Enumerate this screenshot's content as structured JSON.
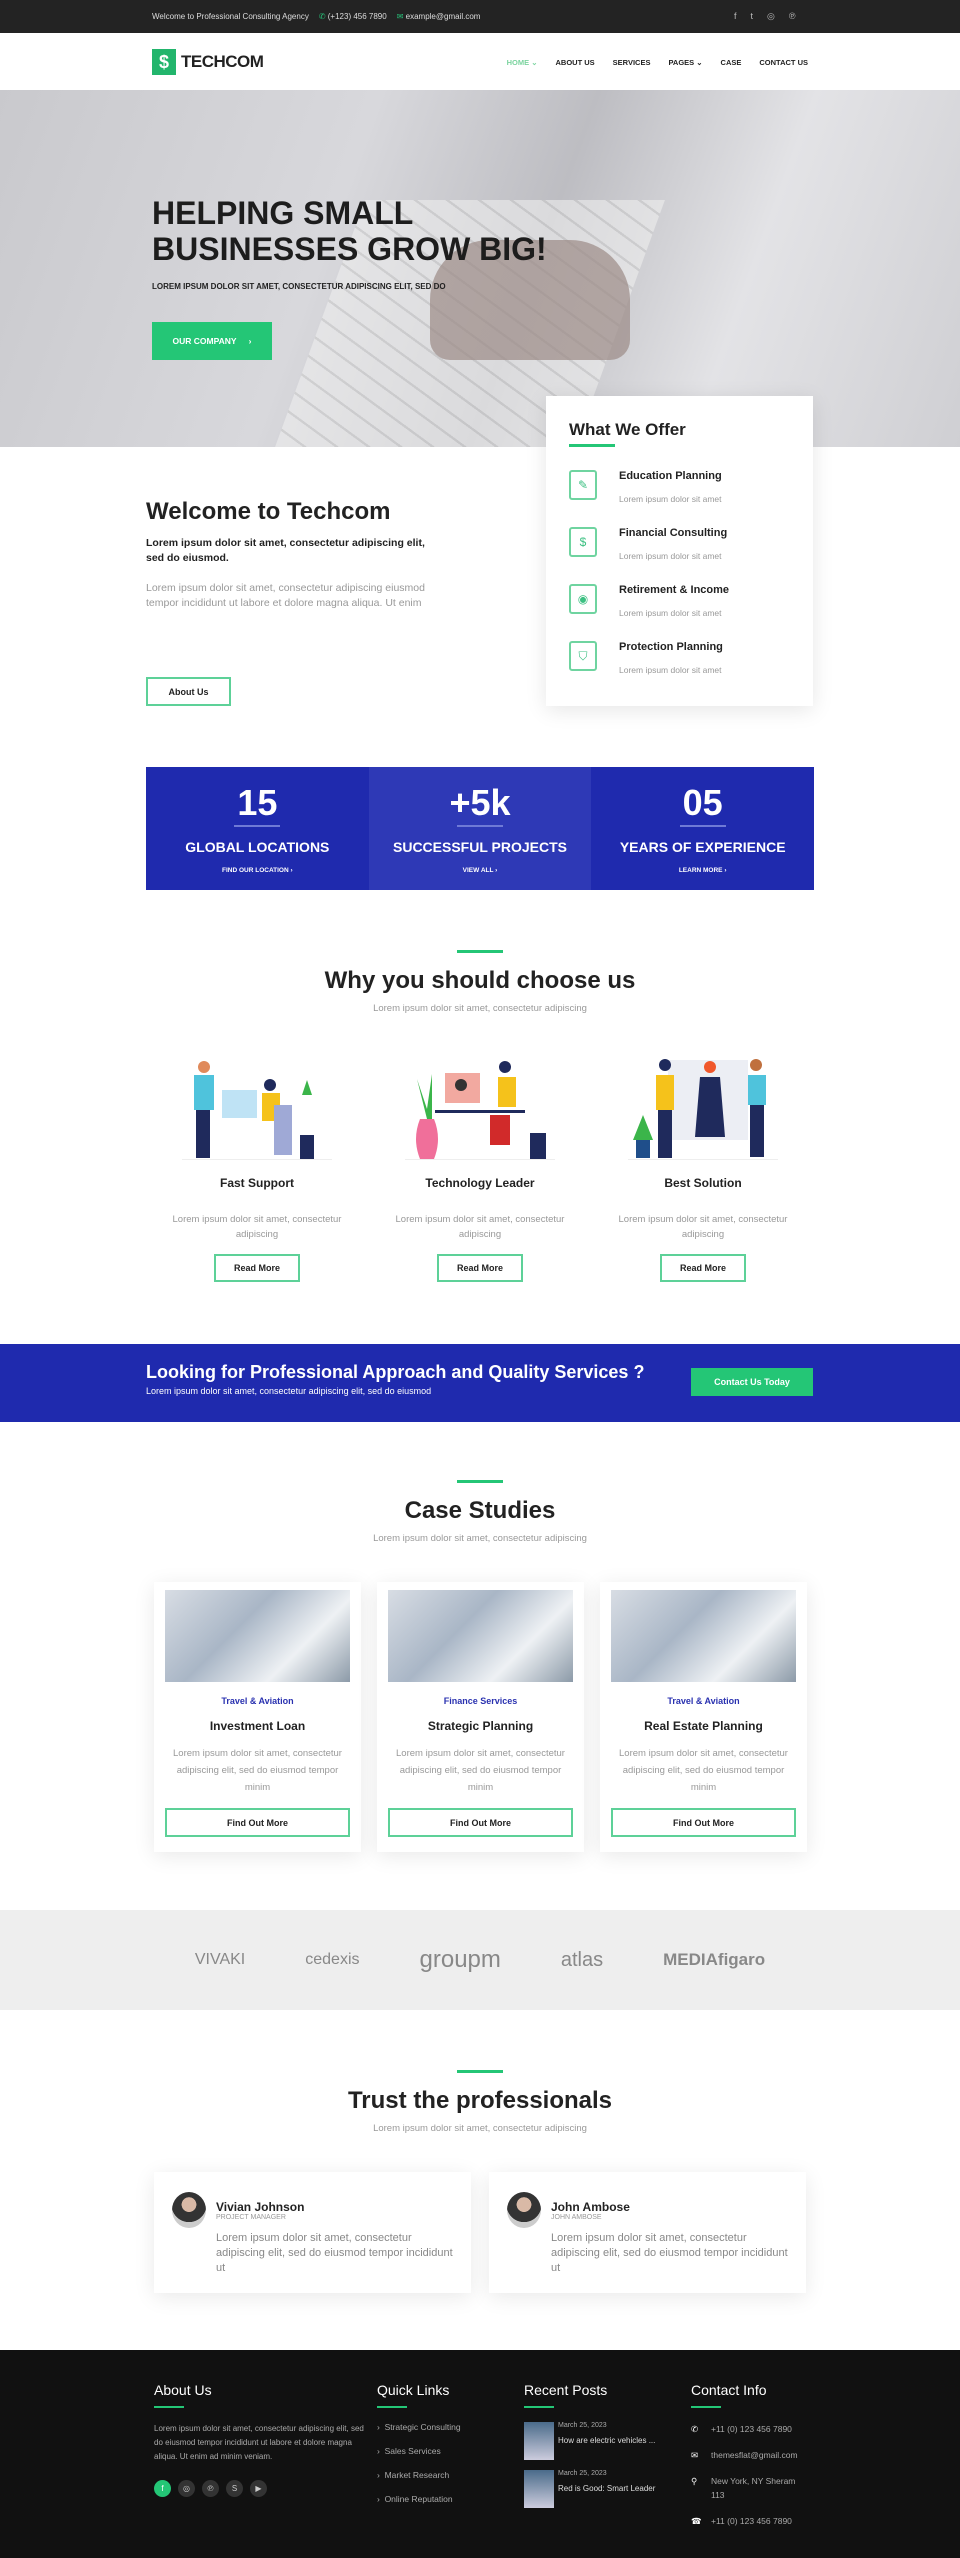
{
  "colors": {
    "accent": "#24c676",
    "brand_blue": "#1f2aae",
    "footer": "#111111"
  },
  "topbar": {
    "welcome": "Welcome to Professional Consulting Agency",
    "phone": "(+123) 456 7890",
    "email": "example@gmail.com",
    "social_icons": [
      "facebook-icon",
      "twitter-icon",
      "instagram-icon",
      "pinterest-icon"
    ]
  },
  "header": {
    "logo_text": "TECHCOM",
    "nav": [
      {
        "label": "HOME",
        "active": true
      },
      {
        "label": "ABOUT US"
      },
      {
        "label": "SERVICES"
      },
      {
        "label": "PAGES"
      },
      {
        "label": "CASE"
      },
      {
        "label": "CONTACT US"
      }
    ]
  },
  "hero": {
    "title_line1": "HELPING SMALL",
    "title_line2": "BUSINESSES GROW BIG!",
    "subtitle": "LOREM IPSUM DOLOR SIT AMET, CONSECTETUR ADIPISCING ELIT, SED DO",
    "button": "OUR COMPANY"
  },
  "offer": {
    "title": "What We Offer",
    "items": [
      {
        "title": "Education Planning",
        "desc": "Lorem ipsum dolor sit amet",
        "icon": "document-pen-icon"
      },
      {
        "title": "Financial Consulting",
        "desc": "Lorem ipsum dolor sit amet",
        "icon": "money-chat-icon"
      },
      {
        "title": "Retirement & Income",
        "desc": "Lorem ipsum dolor sit amet",
        "icon": "safe-icon"
      },
      {
        "title": "Protection Planning",
        "desc": "Lorem ipsum dolor sit amet",
        "icon": "shield-browser-icon"
      }
    ]
  },
  "welcome": {
    "title": "Welcome to Techcom",
    "bold": "Lorem ipsum dolor sit amet, consectetur adipiscing elit, sed do eiusmod.",
    "text": "Lorem ipsum dolor sit amet, consectetur adipiscing eiusmod tempor incididunt ut labore et dolore magna aliqua. Ut enim",
    "button": "About Us"
  },
  "stats": [
    {
      "number": "15",
      "label": "GLOBAL LOCATIONS",
      "link": "FIND OUR LOCATION"
    },
    {
      "number": "+5k",
      "label": "SUCCESSFUL PROJECTS",
      "link": "VIEW ALL"
    },
    {
      "number": "05",
      "label": "YEARS OF EXPERIENCE",
      "link": "LEARN MORE"
    }
  ],
  "why": {
    "title": "Why you should choose us",
    "subtitle": "Lorem ipsum dolor sit amet, consectetur adipiscing",
    "items": [
      {
        "title": "Fast Support",
        "desc": "Lorem ipsum dolor sit amet, consectetur adipiscing",
        "button": "Read More"
      },
      {
        "title": "Technology Leader",
        "desc": "Lorem ipsum dolor sit amet, consectetur adipiscing",
        "button": "Read More"
      },
      {
        "title": "Best Solution",
        "desc": "Lorem ipsum dolor sit amet, consectetur adipiscing",
        "button": "Read More"
      }
    ]
  },
  "cta": {
    "title": "Looking for Professional Approach and Quality Services ?",
    "text": "Lorem ipsum dolor sit amet, consectetur adipiscing elit, sed do eiusmod",
    "button": "Contact Us Today"
  },
  "cases": {
    "title": "Case Studies",
    "subtitle": "Lorem ipsum dolor sit amet, consectetur adipiscing",
    "items": [
      {
        "category": "Travel & Aviation",
        "title": "Investment Loan",
        "desc": "Lorem ipsum dolor sit amet, consectetur adipiscing elit, sed do eiusmod tempor minim",
        "button": "Find Out More"
      },
      {
        "category": "Finance Services",
        "title": "Strategic Planning",
        "desc": "Lorem ipsum dolor sit amet, consectetur adipiscing elit, sed do eiusmod tempor minim",
        "button": "Find Out More"
      },
      {
        "category": "Travel & Aviation",
        "title": "Real Estate Planning",
        "desc": "Lorem ipsum dolor sit amet, consectetur adipiscing elit, sed do eiusmod tempor minim",
        "button": "Find Out More"
      }
    ]
  },
  "logos": [
    "VIVAKI",
    "cedexis",
    "groupm",
    "atlas",
    "MEDIAfigaro"
  ],
  "trust": {
    "title": "Trust the professionals",
    "subtitle": "Lorem ipsum dolor sit amet, consectetur adipiscing",
    "items": [
      {
        "name": "Vivian Johnson",
        "role": "PROJECT MANAGER",
        "text": "Lorem ipsum dolor sit amet, consectetur adipiscing elit, sed do eiusmod tempor incididunt ut"
      },
      {
        "name": "John Ambose",
        "role": "JOHN AMBOSE",
        "text": "Lorem ipsum dolor sit amet, consectetur adipiscing elit, sed do eiusmod tempor incididunt ut"
      }
    ]
  },
  "footer": {
    "about": {
      "title": "About Us",
      "text": "Lorem ipsum dolor sit amet, consectetur adipiscing elit, sed do eiusmod tempor incididunt ut labore et dolore magna aliqua. Ut enim ad minim veniam.",
      "social_icons": [
        "facebook-icon",
        "instagram-icon",
        "pinterest-icon",
        "skype-icon",
        "youtube-icon"
      ]
    },
    "links": {
      "title": "Quick Links",
      "items": [
        "Strategic Consulting",
        "Sales Services",
        "Market Research",
        "Online Reputation"
      ]
    },
    "posts": {
      "title": "Recent Posts",
      "items": [
        {
          "date": "March 25, 2023",
          "title": "How are electric vehicles ..."
        },
        {
          "date": "March 25, 2023",
          "title": "Red is Good: Smart Leader"
        }
      ]
    },
    "contact": {
      "title": "Contact Info",
      "phone": "+11 (0) 123 456 7890",
      "email": "themesflat@gmail.com",
      "address": "New York, NY Sheram 113",
      "fax": "+11 (0) 123 456 7890"
    }
  }
}
